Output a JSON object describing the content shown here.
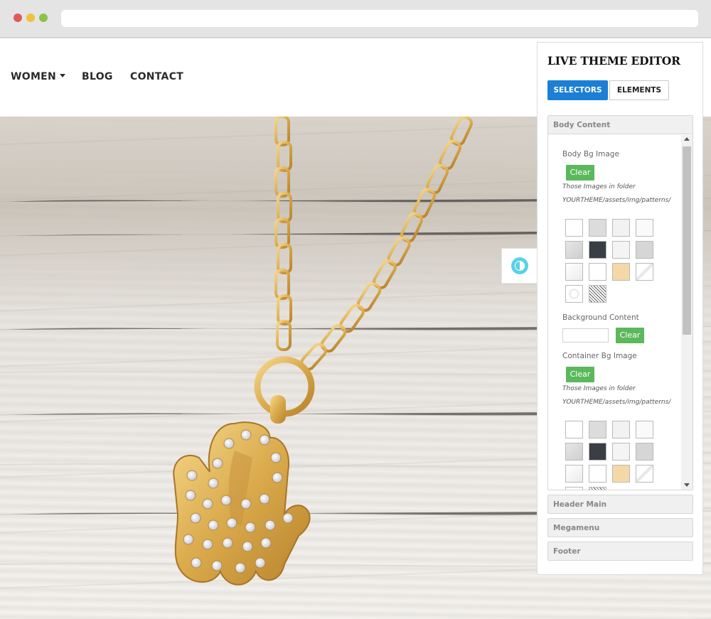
{
  "nav": {
    "items": [
      {
        "label": "WOMEN",
        "has_dropdown": true
      },
      {
        "label": "BLOG"
      },
      {
        "label": "CONTACT"
      }
    ]
  },
  "editor": {
    "title": "LIVE THEME EDITOR",
    "tabs": [
      {
        "label": "SELECTORS",
        "active": true
      },
      {
        "label": "ELEMENTS",
        "active": false
      }
    ],
    "body_content": {
      "header": "Body Content",
      "body_bg_image": {
        "label": "Body Bg Image",
        "clear_label": "Clear",
        "note_line1": "Those Images in folder",
        "note_line2": "YOURTHEME/assets/img/patterns/"
      },
      "background_content": {
        "label": "Background Content",
        "value": "",
        "clear_label": "Clear"
      },
      "container_bg_image": {
        "label": "Container Bg Image",
        "clear_label": "Clear",
        "note_line1": "Those Images in folder",
        "note_line2": "YOURTHEME/assets/img/patterns/"
      }
    },
    "sections": [
      {
        "label": "Header Main"
      },
      {
        "label": "Megamenu"
      },
      {
        "label": "Footer"
      }
    ]
  },
  "colors": {
    "accent_blue": "#1b7fd6",
    "clear_green": "#5cb85c",
    "toggle_cyan": "#5ad1e8"
  },
  "icons": {
    "dropdown": "caret-down-icon",
    "toggle": "contrast-icon"
  }
}
